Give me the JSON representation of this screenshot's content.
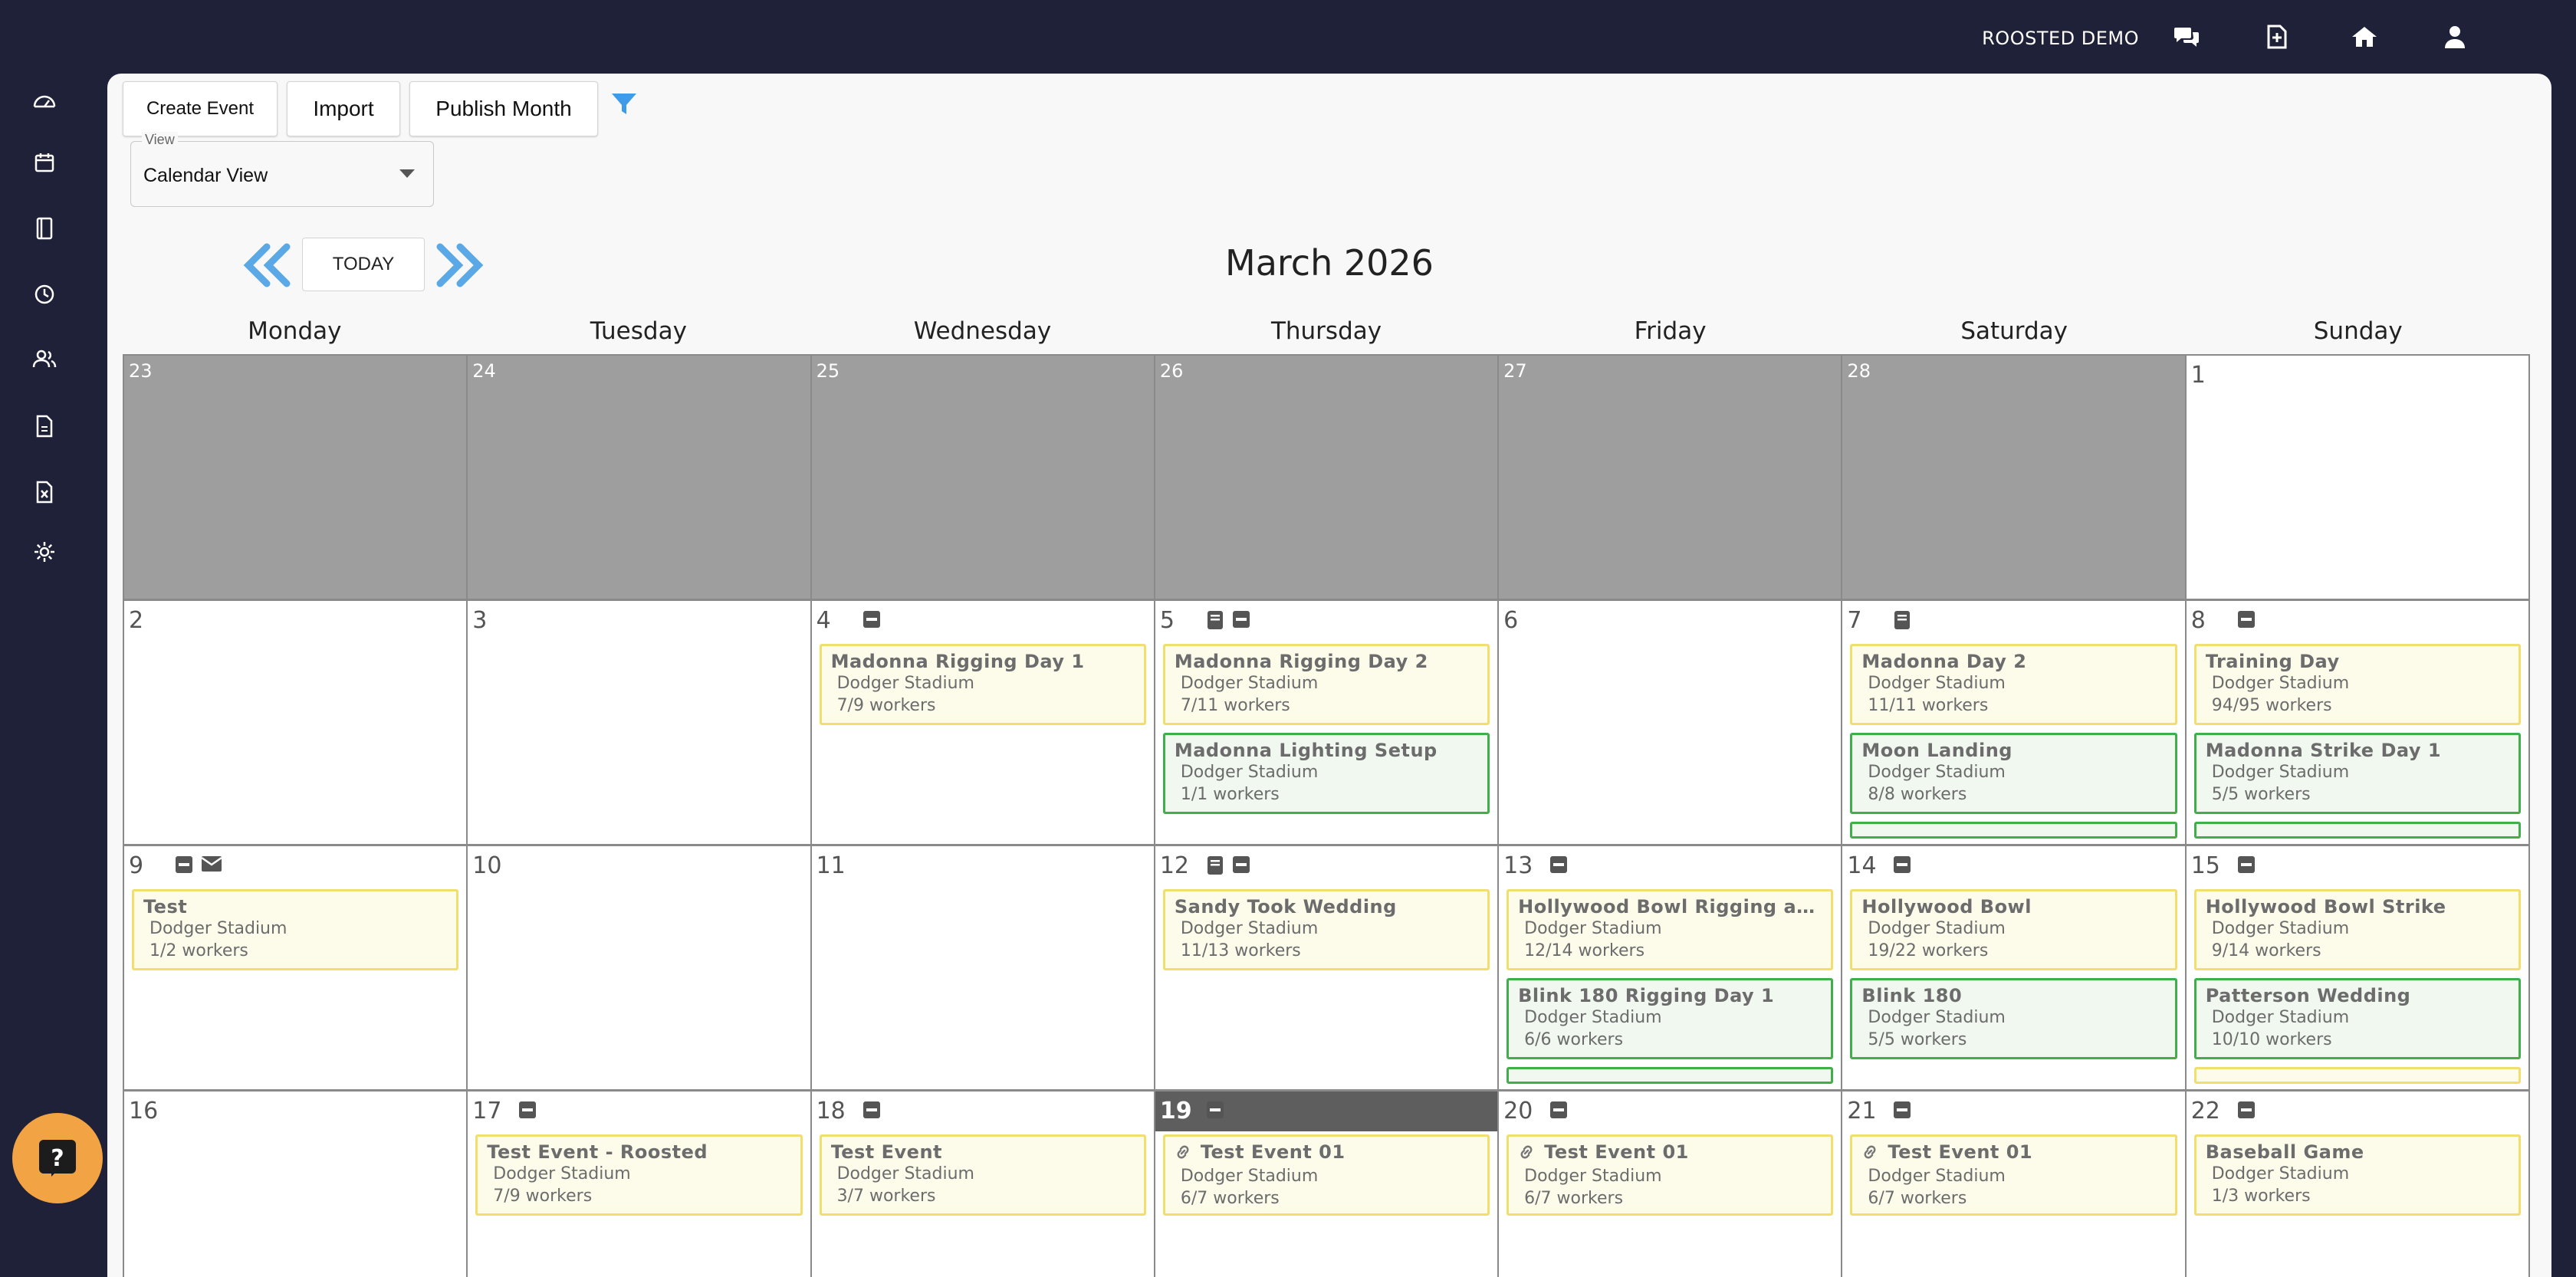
{
  "topbar": {
    "brand": "ROOSTED DEMO",
    "icons": [
      "chat-icon",
      "add-document-icon",
      "home-icon",
      "user-icon"
    ]
  },
  "sidebar": {
    "icons": [
      "dashboard-icon",
      "calendar-icon",
      "document-icon",
      "clock-icon",
      "people-icon",
      "file-icon",
      "spreadsheet-icon",
      "settings-icon"
    ]
  },
  "toolbar": {
    "create_event": "Create Event",
    "import": "Import",
    "publish_month": "Publish Month"
  },
  "view": {
    "legend": "View",
    "value": "Calendar View"
  },
  "nav": {
    "today": "TODAY"
  },
  "month_title": "March 2026",
  "weekdays": [
    "Monday",
    "Tuesday",
    "Wednesday",
    "Thursday",
    "Friday",
    "Saturday",
    "Sunday"
  ],
  "colors": {
    "event_yellow_border": "#f2de6c",
    "event_green_border": "#3fae4b",
    "past_day": "#9e9e9e",
    "today_header": "#5e5e5e",
    "help_button": "#f2a444"
  },
  "days": [
    {
      "num": "23",
      "past": true,
      "events": []
    },
    {
      "num": "24",
      "past": true,
      "events": []
    },
    {
      "num": "25",
      "past": true,
      "events": []
    },
    {
      "num": "26",
      "past": true,
      "events": []
    },
    {
      "num": "27",
      "past": true,
      "events": []
    },
    {
      "num": "28",
      "past": true,
      "events": []
    },
    {
      "num": "1",
      "events": []
    },
    {
      "num": "2",
      "events": []
    },
    {
      "num": "3",
      "events": []
    },
    {
      "num": "4",
      "badges": [
        "minus-icon"
      ],
      "events": [
        {
          "title": "Madonna Rigging Day 1",
          "venue": "Dodger Stadium",
          "workers": "7/9 workers",
          "color": "yellow"
        }
      ]
    },
    {
      "num": "5",
      "badges": [
        "notebook-icon",
        "minus-icon"
      ],
      "events": [
        {
          "title": "Madonna Rigging Day 2",
          "venue": "Dodger Stadium",
          "workers": "7/11 workers",
          "color": "yellow"
        },
        {
          "title": "Madonna Lighting Setup",
          "venue": "Dodger Stadium",
          "workers": "1/1 workers",
          "color": "green"
        }
      ]
    },
    {
      "num": "6",
      "events": []
    },
    {
      "num": "7",
      "badges": [
        "notebook-icon"
      ],
      "events": [
        {
          "title": "Madonna Day 2",
          "venue": "Dodger Stadium",
          "workers": "11/11 workers",
          "color": "yellow"
        },
        {
          "title": "Moon Landing",
          "venue": "Dodger Stadium",
          "workers": "8/8 workers",
          "color": "green"
        },
        {
          "title": "",
          "venue": "",
          "workers": "",
          "color": "green",
          "partial": true
        }
      ]
    },
    {
      "num": "8",
      "badges": [
        "minus-icon"
      ],
      "events": [
        {
          "title": "Training Day",
          "venue": "Dodger Stadium",
          "workers": "94/95 workers",
          "color": "yellow"
        },
        {
          "title": "Madonna Strike Day 1",
          "venue": "Dodger Stadium",
          "workers": "5/5 workers",
          "color": "green"
        },
        {
          "title": "",
          "venue": "",
          "workers": "",
          "color": "green",
          "partial": true
        }
      ]
    },
    {
      "num": "9",
      "badges": [
        "minus-icon",
        "envelope-icon"
      ],
      "events": [
        {
          "title": "Test",
          "venue": "Dodger Stadium",
          "workers": "1/2 workers",
          "color": "yellow"
        }
      ]
    },
    {
      "num": "10",
      "events": []
    },
    {
      "num": "11",
      "events": []
    },
    {
      "num": "12",
      "badges": [
        "notebook-icon",
        "minus-icon"
      ],
      "events": [
        {
          "title": "Sandy Took Wedding",
          "venue": "Dodger Stadium",
          "workers": "11/13 workers",
          "color": "yellow"
        }
      ]
    },
    {
      "num": "13",
      "badges": [
        "minus-icon"
      ],
      "events": [
        {
          "title": "Hollywood Bowl Rigging and...",
          "venue": "Dodger Stadium",
          "workers": "12/14 workers",
          "color": "yellow"
        },
        {
          "title": "Blink 180 Rigging Day 1",
          "venue": "Dodger Stadium",
          "workers": "6/6 workers",
          "color": "green"
        },
        {
          "title": "",
          "venue": "",
          "workers": "",
          "color": "green",
          "partial": true
        }
      ]
    },
    {
      "num": "14",
      "badges": [
        "minus-icon"
      ],
      "events": [
        {
          "title": "Hollywood Bowl",
          "venue": "Dodger Stadium",
          "workers": "19/22 workers",
          "color": "yellow"
        },
        {
          "title": "Blink 180",
          "venue": "Dodger Stadium",
          "workers": "5/5 workers",
          "color": "green"
        }
      ]
    },
    {
      "num": "15",
      "badges": [
        "minus-icon"
      ],
      "events": [
        {
          "title": "Hollywood Bowl Strike",
          "venue": "Dodger Stadium",
          "workers": "9/14 workers",
          "color": "yellow"
        },
        {
          "title": "Patterson Wedding",
          "venue": "Dodger Stadium",
          "workers": "10/10 workers",
          "color": "green"
        },
        {
          "title": "",
          "venue": "",
          "workers": "",
          "color": "yellow",
          "partial": true
        }
      ]
    },
    {
      "num": "16",
      "events": []
    },
    {
      "num": "17",
      "badges": [
        "minus-icon"
      ],
      "events": [
        {
          "title": "Test Event - Roosted",
          "venue": "Dodger Stadium",
          "workers": "7/9 workers",
          "color": "yellow"
        }
      ]
    },
    {
      "num": "18",
      "badges": [
        "minus-icon"
      ],
      "events": [
        {
          "title": "Test Event",
          "venue": "Dodger Stadium",
          "workers": "3/7 workers",
          "color": "yellow"
        }
      ]
    },
    {
      "num": "19",
      "today": true,
      "badges": [
        "minus-icon"
      ],
      "events": [
        {
          "title": "Test Event 01",
          "venue": "Dodger Stadium",
          "workers": "6/7 workers",
          "color": "yellow",
          "linked": true
        }
      ]
    },
    {
      "num": "20",
      "badges": [
        "minus-icon"
      ],
      "events": [
        {
          "title": "Test Event 01",
          "venue": "Dodger Stadium",
          "workers": "6/7 workers",
          "color": "yellow",
          "linked": true
        }
      ]
    },
    {
      "num": "21",
      "badges": [
        "minus-icon"
      ],
      "events": [
        {
          "title": "Test Event 01",
          "venue": "Dodger Stadium",
          "workers": "6/7 workers",
          "color": "yellow",
          "linked": true
        }
      ]
    },
    {
      "num": "22",
      "badges": [
        "minus-icon"
      ],
      "events": [
        {
          "title": "Baseball Game",
          "venue": "Dodger Stadium",
          "workers": "1/3 workers",
          "color": "yellow"
        }
      ]
    }
  ]
}
